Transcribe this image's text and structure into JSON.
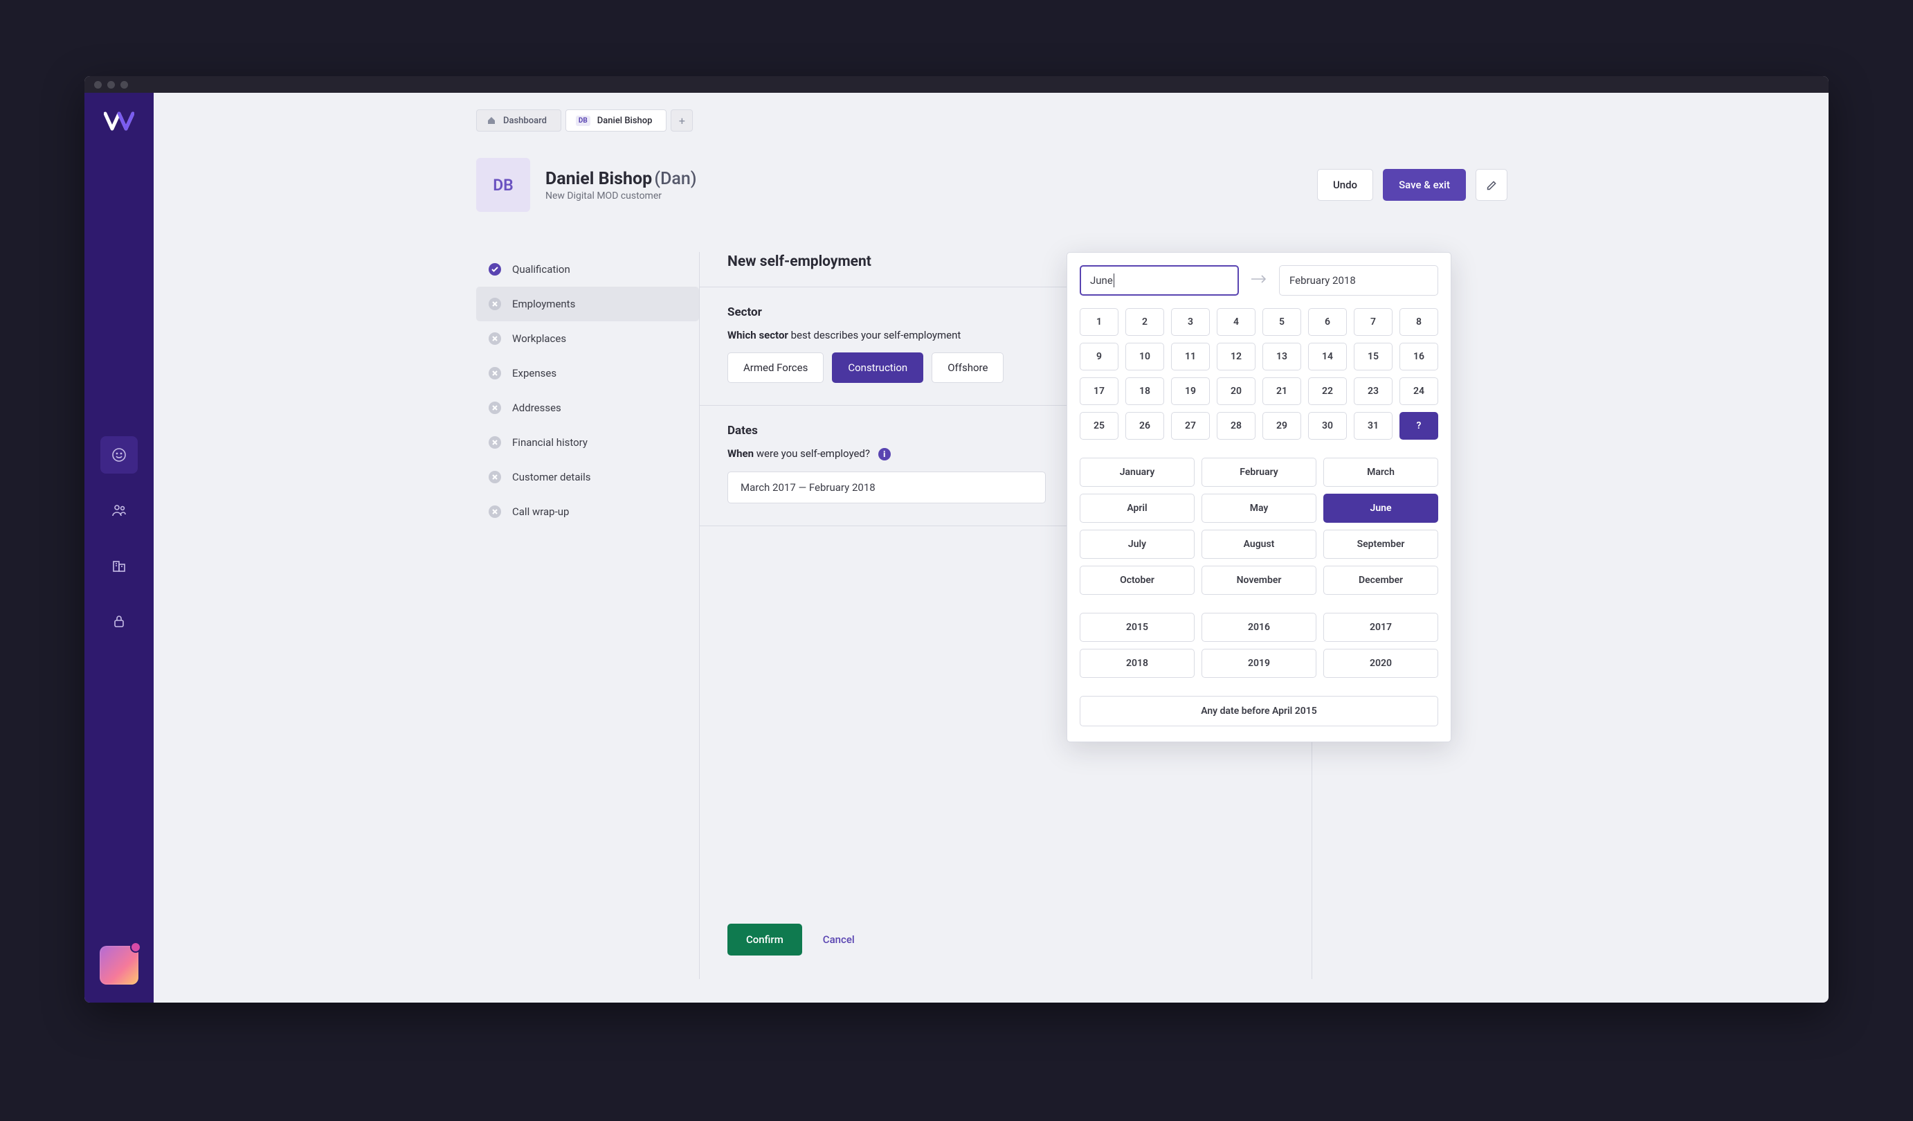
{
  "window": {
    "tabs": [
      {
        "label": "Dashboard",
        "badge": null,
        "active": false
      },
      {
        "label": "Daniel Bishop",
        "badge": "DB",
        "active": true
      }
    ]
  },
  "header": {
    "avatar_initials": "DB",
    "name": "Daniel Bishop",
    "alias": "(Dan)",
    "subtitle": "New Digital MOD customer",
    "actions": {
      "undo": "Undo",
      "save_exit": "Save & exit"
    }
  },
  "nav": {
    "items": [
      {
        "label": "Qualification",
        "state": "done"
      },
      {
        "label": "Employments",
        "state": "todo",
        "active": true
      },
      {
        "label": "Workplaces",
        "state": "todo"
      },
      {
        "label": "Expenses",
        "state": "todo"
      },
      {
        "label": "Addresses",
        "state": "todo"
      },
      {
        "label": "Financial history",
        "state": "todo"
      },
      {
        "label": "Customer details",
        "state": "todo"
      },
      {
        "label": "Call wrap-up",
        "state": "todo"
      }
    ]
  },
  "form": {
    "title": "New self-employment",
    "sector": {
      "heading": "Sector",
      "question_strong": "Which sector",
      "question_rest": " best describes your self-employment",
      "options": [
        {
          "label": "Armed Forces",
          "selected": false
        },
        {
          "label": "Construction",
          "selected": true
        },
        {
          "label": "Offshore",
          "selected": false
        }
      ]
    },
    "dates": {
      "heading": "Dates",
      "question_strong": "When",
      "question_rest": " were you self-employed?",
      "range_display": "March 2017 — February 2018"
    },
    "confirm": "Confirm",
    "cancel": "Cancel"
  },
  "datepicker": {
    "from_value": "June",
    "to_value": "February 2018",
    "days": [
      "1",
      "2",
      "3",
      "4",
      "5",
      "6",
      "7",
      "8",
      "9",
      "10",
      "11",
      "12",
      "13",
      "14",
      "15",
      "16",
      "17",
      "18",
      "19",
      "20",
      "21",
      "22",
      "23",
      "24",
      "25",
      "26",
      "27",
      "28",
      "29",
      "30",
      "31",
      "?"
    ],
    "day_selected_index": 31,
    "months": [
      "January",
      "February",
      "March",
      "April",
      "May",
      "June",
      "July",
      "August",
      "September",
      "October",
      "November",
      "December"
    ],
    "month_selected_index": 5,
    "years": [
      "2015",
      "2016",
      "2017",
      "2018",
      "2019",
      "2020"
    ],
    "any_date": "Any date before April 2015"
  }
}
